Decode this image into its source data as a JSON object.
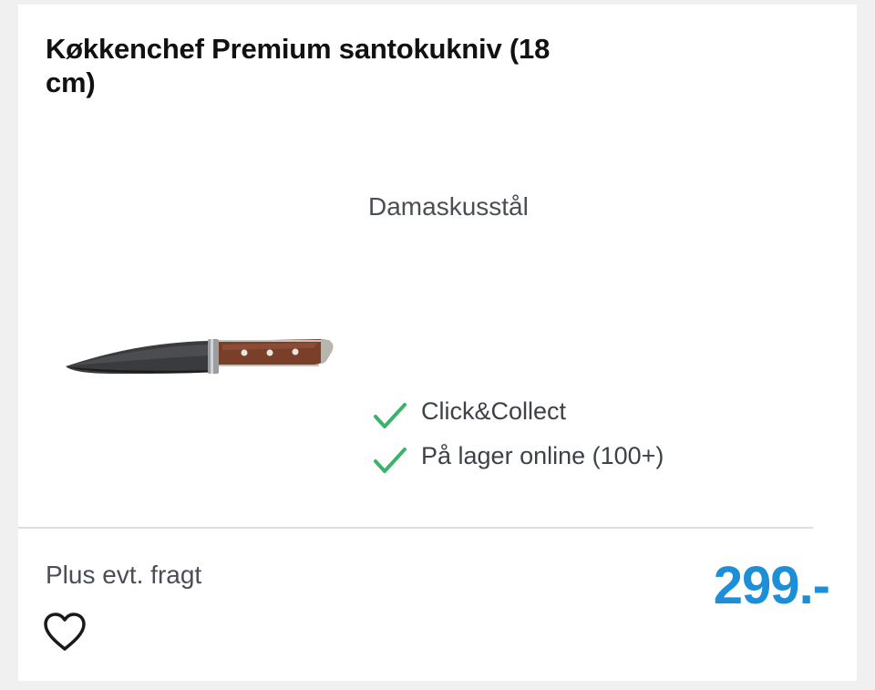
{
  "product": {
    "title": "Køkkenchef Premium santokukniv (18 cm)",
    "material": "Damaskusstål",
    "availability": [
      {
        "label": "Click&Collect",
        "icon": "checkmark-icon"
      },
      {
        "label": "På lager online (100+)",
        "icon": "checkmark-icon"
      }
    ],
    "shipping_note": "Plus evt. fragt",
    "price": "299.-",
    "favorite_icon": "heart-outline-icon"
  },
  "colors": {
    "price": "#1d8fd6",
    "check": "#3bb46b",
    "title": "#111111",
    "muted_text": "#4a4f55"
  }
}
